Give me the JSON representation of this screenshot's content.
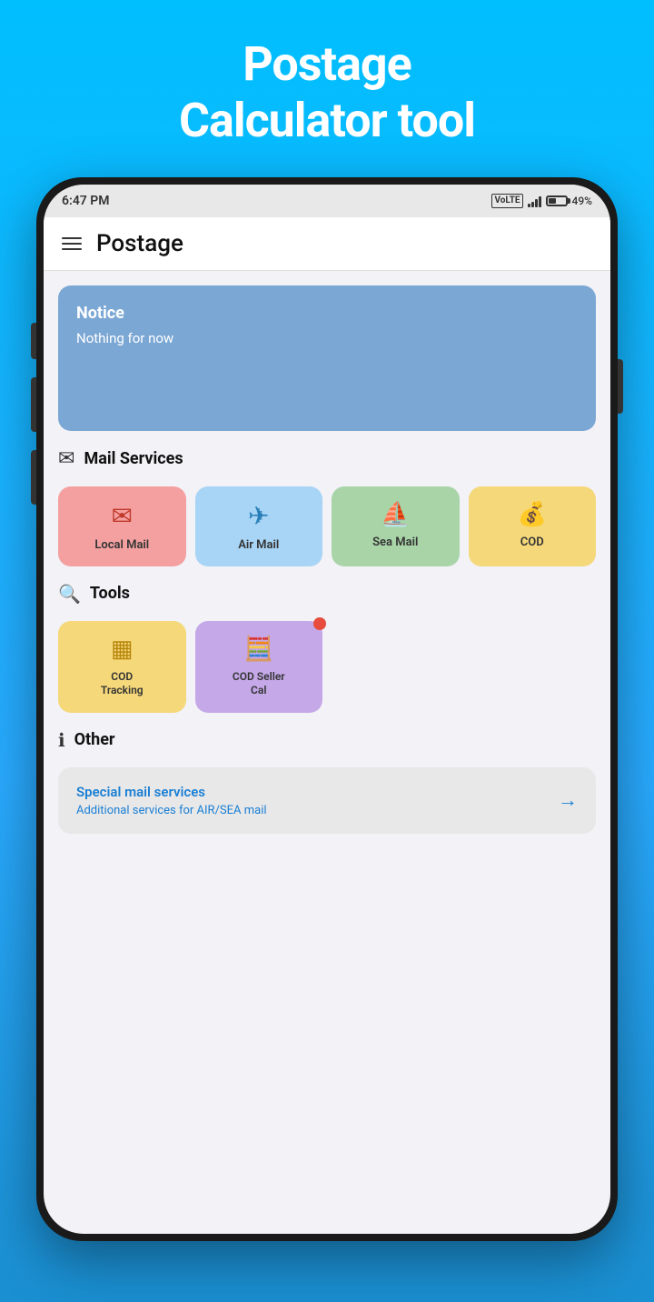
{
  "appTitle": {
    "line1": "Postage",
    "line2": "Calculator tool"
  },
  "statusBar": {
    "time": "6:47 PM",
    "battery": "49%",
    "volte": "Vo\nLTE"
  },
  "header": {
    "title": "Postage"
  },
  "notice": {
    "title": "Notice",
    "body": "Nothing for now"
  },
  "mailServices": {
    "sectionTitle": "Mail Services",
    "items": [
      {
        "id": "local",
        "label": "Local Mail",
        "icon": "✉"
      },
      {
        "id": "air",
        "label": "Air Mail",
        "icon": "✈"
      },
      {
        "id": "sea",
        "label": "Sea Mail",
        "icon": "🚢"
      },
      {
        "id": "cod",
        "label": "COD",
        "icon": "💳"
      }
    ]
  },
  "tools": {
    "sectionTitle": "Tools",
    "items": [
      {
        "id": "cod-tracking",
        "label": "COD\nTracking",
        "icon": "▦"
      },
      {
        "id": "cod-seller",
        "label": "COD Seller\nCal",
        "icon": "⊞"
      }
    ]
  },
  "other": {
    "sectionTitle": "Other",
    "card": {
      "title": "Special mail services",
      "subtitle": "Additional services for AIR/SEA mail",
      "arrow": "→"
    }
  }
}
